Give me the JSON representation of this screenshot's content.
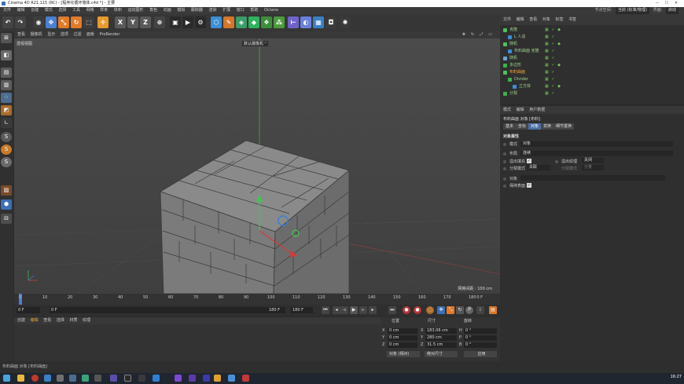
{
  "window": {
    "title": "Cinema 4D R21.115 (RC) - [程序化循环墙体.c4d *] - 主要"
  },
  "menubar": {
    "items": [
      "文件",
      "编辑",
      "创建",
      "模式",
      "选择",
      "工具",
      "网格",
      "样条",
      "体积",
      "运动图形",
      "角色",
      "动画",
      "模拟",
      "跟踪器",
      "渲染",
      "扩展",
      "窗口",
      "帮助",
      "Octane"
    ],
    "node_space_label": "节点空间:",
    "node_space_value": "当前 (标准/物理)",
    "layout_label": "界面:",
    "layout_value": "启动"
  },
  "viewport": {
    "menu": [
      "查看",
      "摄像机",
      "显示",
      "选项",
      "过滤",
      "面板",
      "ProRender"
    ],
    "view_label": "透视视图",
    "camera_label": "默认摄像机 ᵒ",
    "grid_label": "网格间距 : 100 cm"
  },
  "timeline": {
    "ticks": [
      "0",
      "10",
      "20",
      "30",
      "40",
      "50",
      "60",
      "70",
      "80",
      "90",
      "100",
      "110",
      "120",
      "130",
      "140",
      "150",
      "160",
      "170",
      "180"
    ],
    "end_frame": "0 F"
  },
  "transport": {
    "start_field": "0 F",
    "current_field": "0 F",
    "end_field": "180 F",
    "end_field2": "180 F"
  },
  "materials": {
    "menu": [
      "创建",
      "编辑",
      "查看",
      "选择",
      "材质",
      "纹理"
    ]
  },
  "coordinates": {
    "headers": [
      "位置",
      "尺寸",
      "旋转"
    ],
    "rows": [
      {
        "axis": "X",
        "pos": "0 cm",
        "size_axis": "X",
        "size": "183.06 cm",
        "rot_axis": "H",
        "rot": "0 °"
      },
      {
        "axis": "Y",
        "pos": "0 cm",
        "size_axis": "Y",
        "size": "280 cm",
        "rot_axis": "P",
        "rot": "0 °"
      },
      {
        "axis": "Z",
        "pos": "0 cm",
        "size_axis": "Z",
        "size": "31.5 cm",
        "rot_axis": "B",
        "rot": "0 °"
      }
    ],
    "mode_select": "对象 (相对)",
    "size_select": "绝对尺寸",
    "apply_button": "应用"
  },
  "status": {
    "text": "布料曲面 对象 [布料曲面]"
  },
  "taskbar": {
    "clock": "16:27"
  },
  "object_manager": {
    "menu": [
      "文件",
      "编辑",
      "查看",
      "对象",
      "标签",
      "书签"
    ],
    "objects": [
      {
        "name": "克隆",
        "indent": 0,
        "color": "#7ad16a"
      },
      {
        "name": "L 人造",
        "indent": 1,
        "color": "#7ad16a"
      },
      {
        "name": "随机",
        "indent": 0,
        "color": "#7ad16a"
      },
      {
        "name": "布料曲面 克隆",
        "indent": 1,
        "color": "#7ad16a"
      },
      {
        "name": "随机",
        "indent": 0,
        "color": "#7ad16a"
      },
      {
        "name": "多边形",
        "indent": 0,
        "color": "#7ad16a"
      },
      {
        "name": "布料曲面",
        "indent": 0,
        "color": "#f0a640"
      },
      {
        "name": "Divider",
        "indent": 1,
        "color": "#7ad16a"
      },
      {
        "name": "立方体",
        "indent": 2,
        "color": "#7ad16a"
      },
      {
        "name": "分裂",
        "indent": 0,
        "color": "#7ad16a"
      }
    ]
  },
  "attributes": {
    "menu": [
      "模式",
      "编辑",
      "用户数据"
    ],
    "object_title": "布料曲面 对象 [布料]",
    "tabs": [
      "基本",
      "坐标",
      "对象",
      "变换",
      "细节置换"
    ],
    "active_tab": "对象",
    "section": "对象属性",
    "mode_label": "模式",
    "mode_value": "对象",
    "layer_label": "布局",
    "layer_value": "连续",
    "fill_holes_label": "溢出填充",
    "fill_mode_label": "溢出纹理",
    "fill_mode_value": "关闭",
    "split_mode_label": "分裂模式",
    "split_mode_value": "关联",
    "split_size_label": "分裂模式",
    "split_size_value": "分量",
    "object_label": "对象",
    "keep_label": "保持表面"
  }
}
